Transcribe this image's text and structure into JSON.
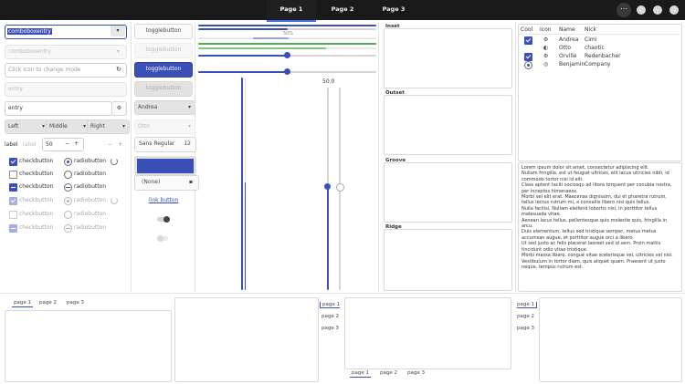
{
  "header": {
    "tabs": [
      {
        "label": "Page 1",
        "active": true
      },
      {
        "label": "Page 2",
        "active": false
      },
      {
        "label": "Page 3",
        "active": false
      }
    ],
    "menu_icon": "more-icon"
  },
  "col1": {
    "combo_entry": "comboboxentry",
    "combo_entry_disabled": "comboboxentry",
    "icon_entry_placeholder": "Click icon to change mode",
    "entry_disabled_placeholder": "entry",
    "entry_value": "entry",
    "seg": [
      "Left",
      "Middle",
      "Right"
    ],
    "label_text": "label",
    "label_disabled": "label",
    "spin_value": "50",
    "check_label": "checkbutton",
    "radio_label": "radiobutton"
  },
  "col2": {
    "toggle_labels": [
      "togglebutton",
      "togglebutton",
      "togglebutton",
      "togglebutton"
    ],
    "combo1": "Andrea",
    "combo2": "Otto",
    "font_name": "Sans Regular",
    "font_size": "12",
    "file_chooser": "(None)",
    "link": "link button"
  },
  "col3": {
    "progress_label": "50%",
    "scale_value": "50.0",
    "progress": [
      1.0,
      0.5,
      0.2,
      1.0
    ]
  },
  "frames": [
    "Inset",
    "Outset",
    "Groove",
    "Ridge"
  ],
  "tree": {
    "headers": [
      "Cool",
      "Icon",
      "Name",
      "Nick"
    ],
    "rows": [
      {
        "cool": "check",
        "icon": "gear-icon",
        "name": "Andrea",
        "nick": "Cimi"
      },
      {
        "cool": "none",
        "icon": "half-circle-icon",
        "name": "Otto",
        "nick": "chaotic"
      },
      {
        "cool": "check",
        "icon": "settings-icon",
        "name": "Orville",
        "nick": "Redenbacher"
      },
      {
        "cool": "radio",
        "icon": "dial-icon",
        "name": "Benjamin",
        "nick": "Company"
      }
    ]
  },
  "lorem": "Lorem ipsum dolor sit amet, consectetur adipiscing elit.\nNullam fringilla, est ut feugiat ultrices, elit lacus ultricies nibh, id commodo tortor nisi id elit.\nClass aptent taciti sociosqu ad litora torquent per conubia nostra, per inceptos himenaeos.\nMorbi vel elit erat. Maecenas dignissim, dui et pharetra rutrum, tellus lectus rutrum mi, a convallis libero nisi quis tellus.\nNulla facilisi. Nullam eleifend lobortis nisl, in porttitor tellus malesuada vitae.\nAenean lacus tellus, pellentesque quis molestie quis, fringilla in arcu.\nDuis elementum, tellus sed tristique semper, metus metus accumsan augue, et porttitor augue orci a libero.\nUt sed justo ac felis placerat laoreet sed id sem. Proin mattis tincidunt odio vitae tristique.\nMorbi massa libero, congue vitae scelerisque vel, ultricies vel nisl.\nVestibulum in tortor diam, quis aliquet quam. Praesent ut justo neque, tempus rutrum est.",
  "notebooks": {
    "tabs": [
      "page 1",
      "page 2",
      "page 3"
    ]
  }
}
